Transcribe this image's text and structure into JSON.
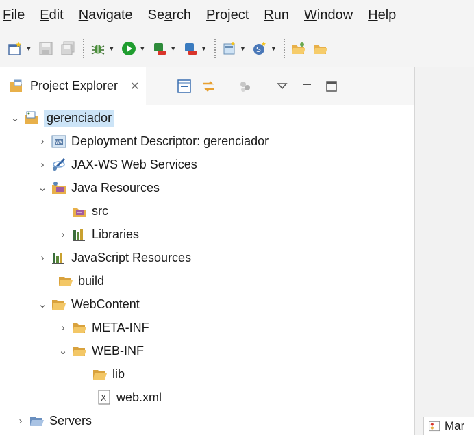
{
  "menu": [
    {
      "label": "File",
      "mnemonic": "F",
      "rest": "ile"
    },
    {
      "label": "Edit",
      "mnemonic": "E",
      "rest": "dit"
    },
    {
      "label": "Navigate",
      "mnemonic": "N",
      "rest": "avigate"
    },
    {
      "label": "Search",
      "pre": "Se",
      "mnemonic": "a",
      "rest": "rch"
    },
    {
      "label": "Project",
      "mnemonic": "P",
      "rest": "roject"
    },
    {
      "label": "Run",
      "mnemonic": "R",
      "rest": "un"
    },
    {
      "label": "Window",
      "mnemonic": "W",
      "rest": "indow"
    },
    {
      "label": "Help",
      "mnemonic": "H",
      "rest": "elp"
    }
  ],
  "view": {
    "tab_label": "Project Explorer",
    "close_glyph": "✕"
  },
  "tree": [
    {
      "id": "gerenciador",
      "label": "gerenciador",
      "icon": "project-icon",
      "expanded": true,
      "selected": true
    },
    {
      "id": "deployment",
      "label": "Deployment Descriptor: gerenciador",
      "icon": "deployment-descriptor-icon",
      "expanded": false
    },
    {
      "id": "jaxws",
      "label": "JAX-WS Web Services",
      "icon": "web-services-icon",
      "expanded": false
    },
    {
      "id": "java-resources",
      "label": "Java Resources",
      "icon": "java-resources-icon",
      "expanded": true
    },
    {
      "id": "src",
      "label": "src",
      "icon": "source-folder-icon"
    },
    {
      "id": "libraries",
      "label": "Libraries",
      "icon": "libraries-icon",
      "expanded": false
    },
    {
      "id": "js-resources",
      "label": "JavaScript Resources",
      "icon": "libraries-icon",
      "expanded": false
    },
    {
      "id": "build",
      "label": "build",
      "icon": "folder-icon"
    },
    {
      "id": "webcontent",
      "label": "WebContent",
      "icon": "folder-icon",
      "expanded": true
    },
    {
      "id": "meta-inf",
      "label": "META-INF",
      "icon": "folder-icon",
      "expanded": false
    },
    {
      "id": "web-inf",
      "label": "WEB-INF",
      "icon": "folder-icon",
      "expanded": true
    },
    {
      "id": "lib",
      "label": "lib",
      "icon": "folder-icon"
    },
    {
      "id": "webxml",
      "label": "web.xml",
      "icon": "xml-file-icon"
    },
    {
      "id": "servers",
      "label": "Servers",
      "icon": "folder-icon",
      "expanded": false
    }
  ],
  "right_panel": {
    "bottom_tab_label": "Mar"
  },
  "colors": {
    "selection": "#cce4f7",
    "folder": "#e8b04a",
    "run_green": "#1f9d2f"
  }
}
